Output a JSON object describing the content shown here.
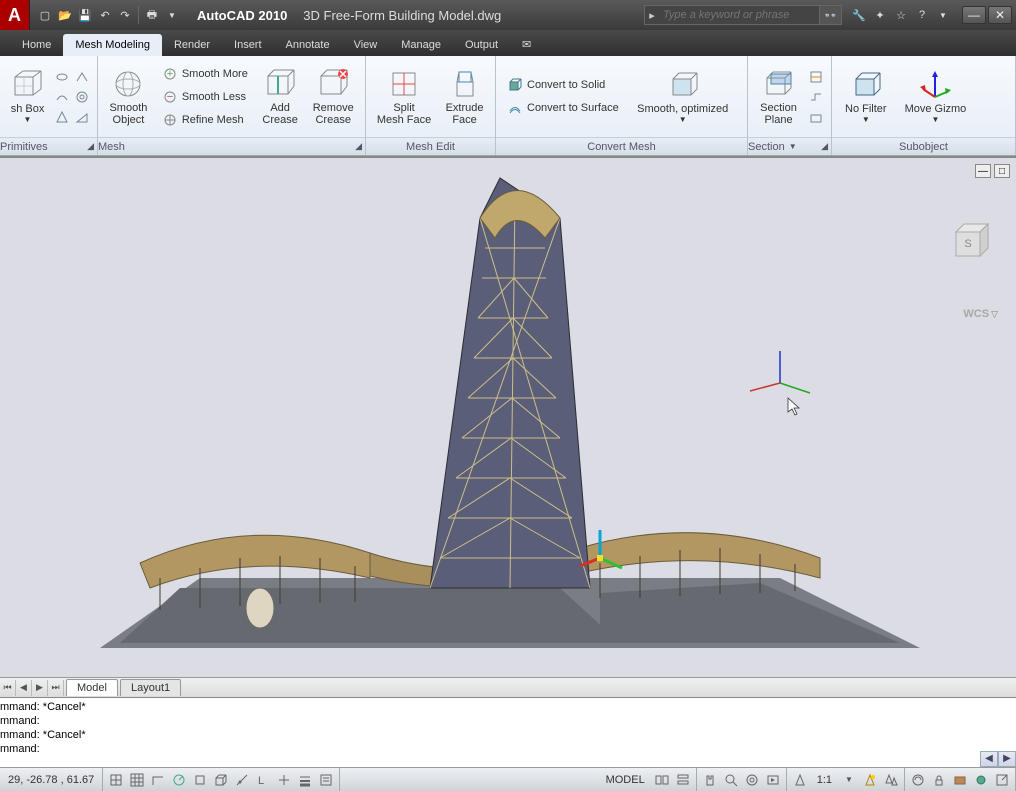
{
  "titlebar": {
    "app_name": "AutoCAD 2010",
    "doc_name": "3D Free-Form Building Model.dwg",
    "search_placeholder": "Type a keyword or phrase"
  },
  "tabs": [
    "Home",
    "Mesh Modeling",
    "Render",
    "Insert",
    "Annotate",
    "View",
    "Manage",
    "Output"
  ],
  "active_tab": 1,
  "ribbon": {
    "primitives": {
      "title": "Primitives",
      "mesh_box": "sh Box"
    },
    "mesh": {
      "title": "Mesh",
      "smooth_object": "Smooth\nObject",
      "smooth_more": "Smooth More",
      "smooth_less": "Smooth Less",
      "refine_mesh": "Refine Mesh",
      "add_crease": "Add\nCrease",
      "remove_crease": "Remove\nCrease"
    },
    "mesh_edit": {
      "title": "Mesh Edit",
      "split_face": "Split\nMesh Face",
      "extrude_face": "Extrude\nFace"
    },
    "convert": {
      "title": "Convert Mesh",
      "to_solid": "Convert to Solid",
      "to_surface": "Convert to Surface",
      "smooth_opt": "Smooth, optimized"
    },
    "section": {
      "title": "Section",
      "section_plane": "Section\nPlane"
    },
    "subobject": {
      "title": "Subobject",
      "no_filter": "No Filter",
      "move_gizmo": "Move Gizmo"
    }
  },
  "viewport": {
    "wcs_label": "WCS"
  },
  "layout_tabs": [
    "Model",
    "Layout1"
  ],
  "command_lines": [
    "mmand: *Cancel*",
    "mmand:",
    "mmand: *Cancel*",
    "mmand:"
  ],
  "statusbar": {
    "coords": "29,  -26.78 , 61.67",
    "model_label": "MODEL",
    "scale": "1:1"
  }
}
